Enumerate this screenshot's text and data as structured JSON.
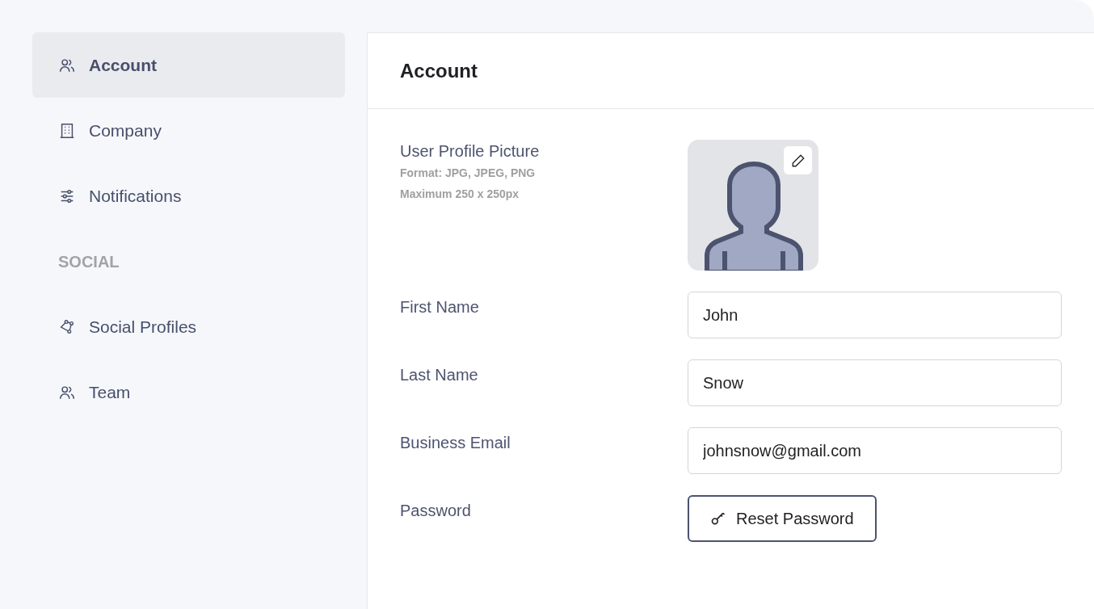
{
  "sidebar": {
    "items": [
      {
        "kind": "link",
        "label": "Account",
        "selected": true
      },
      {
        "kind": "link",
        "label": "Company",
        "selected": false
      },
      {
        "kind": "link",
        "label": "Notifications",
        "selected": false
      },
      {
        "kind": "heading",
        "label": "SOCIAL"
      },
      {
        "kind": "link",
        "label": "Social Profiles",
        "selected": false
      },
      {
        "kind": "link",
        "label": "Team",
        "selected": false
      }
    ]
  },
  "panel": {
    "title": "Account",
    "profile_picture": {
      "label": "User Profile Picture",
      "hints": [
        "Format: JPG, JPEG, PNG",
        "Maximum 250 x 250px"
      ]
    },
    "fields": [
      {
        "label": "First Name",
        "value": "John"
      },
      {
        "label": "Last Name",
        "value": "Snow"
      },
      {
        "label": "Business Email",
        "value": "johnsnow@gmail.com"
      }
    ],
    "password": {
      "label": "Password",
      "button": "Reset Password"
    }
  }
}
